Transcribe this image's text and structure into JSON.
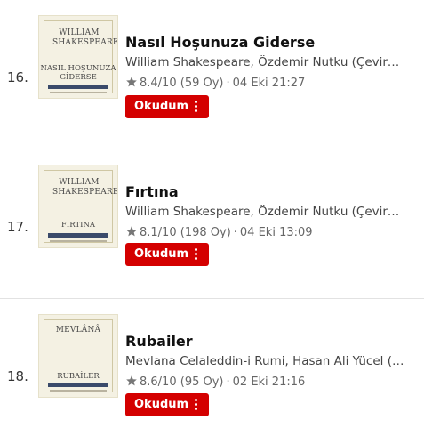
{
  "items": [
    {
      "rank": "16.",
      "title": "Nasıl Hoşunuza Giderse",
      "authors": "William Shakespeare, Özdemir Nutku (Çevirmen)",
      "rating": "8.4/10",
      "votes": "(59 Oy)",
      "date": "04 Eki 21:27",
      "button_label": "Okudum",
      "cover": {
        "author": "WILLIAM SHAKESPEARE",
        "title_line1": "NASIL HOŞUNUZA",
        "title_line2": "GİDERSE"
      }
    },
    {
      "rank": "17.",
      "title": "Fırtına",
      "authors": "William Shakespeare, Özdemir Nutku (Çevirmen)",
      "rating": "8.1/10",
      "votes": "(198 Oy)",
      "date": "04 Eki 13:09",
      "button_label": "Okudum",
      "cover": {
        "author": "WILLIAM SHAKESPEARE",
        "title_line1": "FIRTINA",
        "title_line2": ""
      }
    },
    {
      "rank": "18.",
      "title": "Rubailer",
      "authors": "Mevlana Celaleddin-i Rumi, Hasan Ali Yücel (Çevi...",
      "rating": "8.6/10",
      "votes": "(95 Oy)",
      "date": "02 Eki 21:16",
      "button_label": "Okudum",
      "cover": {
        "author": "MEVLÂNÂ",
        "title_line1": "RUBAİLER",
        "title_line2": ""
      }
    }
  ],
  "separator": "·",
  "colors": {
    "button": "#d40000",
    "cover_band": "#3a4a6a"
  },
  "icons": {
    "rating": "star-icon",
    "menu": "more-vertical-icon"
  }
}
